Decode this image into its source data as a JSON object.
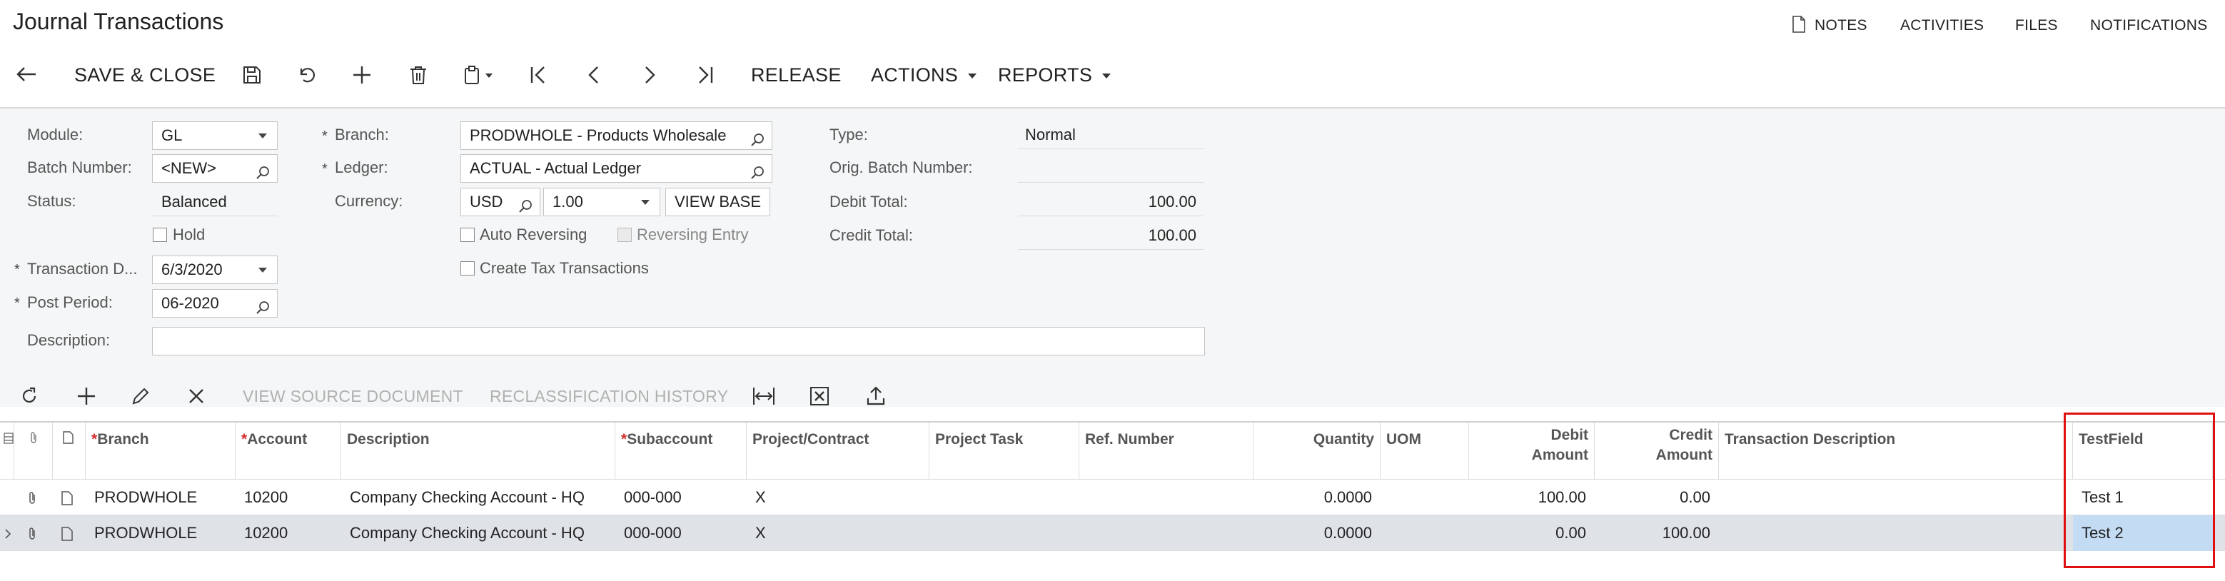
{
  "page": {
    "title": "Journal Transactions",
    "top_links": [
      "NOTES",
      "ACTIVITIES",
      "FILES",
      "NOTIFICATIONS"
    ]
  },
  "toolbar": {
    "save_close": "SAVE & CLOSE",
    "release": "RELEASE",
    "actions": "ACTIONS",
    "reports": "REPORTS"
  },
  "form": {
    "module_label": "Module:",
    "module_value": "GL",
    "batch_label": "Batch Number:",
    "batch_value": "<NEW>",
    "status_label": "Status:",
    "status_value": "Balanced",
    "hold_label": "Hold",
    "trans_date_label": "Transaction D...",
    "trans_date_value": "6/3/2020",
    "post_period_label": "Post Period:",
    "post_period_value": "06-2020",
    "description_label": "Description:",
    "description_value": "",
    "branch_label": "Branch:",
    "branch_value": "PRODWHOLE - Products Wholesale",
    "ledger_label": "Ledger:",
    "ledger_value": "ACTUAL - Actual Ledger",
    "currency_label": "Currency:",
    "currency_value": "USD",
    "rate_value": "1.00",
    "view_base": "VIEW BASE",
    "auto_reversing": "Auto Reversing",
    "reversing_entry": "Reversing Entry",
    "create_tax": "Create Tax Transactions",
    "type_label": "Type:",
    "type_value": "Normal",
    "orig_batch_label": "Orig. Batch Number:",
    "orig_batch_value": "",
    "debit_total_label": "Debit Total:",
    "debit_total_value": "100.00",
    "credit_total_label": "Credit Total:",
    "credit_total_value": "100.00"
  },
  "grid_toolbar": {
    "view_source": "VIEW SOURCE DOCUMENT",
    "reclass_history": "RECLASSIFICATION HISTORY"
  },
  "grid": {
    "headers": {
      "branch": "Branch",
      "account": "Account",
      "description": "Description",
      "subaccount": "Subaccount",
      "project": "Project/Contract",
      "task": "Project Task",
      "ref": "Ref. Number",
      "quantity": "Quantity",
      "uom": "UOM",
      "debit_1": "Debit",
      "debit_2": "Amount",
      "credit_1": "Credit",
      "credit_2": "Amount",
      "trans_desc": "Transaction Description",
      "testfield": "TestField"
    },
    "rows": [
      {
        "branch": "PRODWHOLE",
        "account": "10200",
        "description": "Company Checking Account - HQ",
        "subaccount": "000-000",
        "project": "X",
        "task": "",
        "ref": "",
        "quantity": "0.0000",
        "uom": "",
        "debit": "100.00",
        "credit": "0.00",
        "trans_desc": "",
        "testfield": "Test 1"
      },
      {
        "branch": "PRODWHOLE",
        "account": "10200",
        "description": "Company Checking Account - HQ",
        "subaccount": "000-000",
        "project": "X",
        "task": "",
        "ref": "",
        "quantity": "0.0000",
        "uom": "",
        "debit": "0.00",
        "credit": "100.00",
        "trans_desc": "",
        "testfield": "Test 2"
      }
    ]
  },
  "colors": {
    "highlight_border": "#e01010",
    "selected_row": "#dfe3e8",
    "active_cell": "#c3dcf4"
  }
}
